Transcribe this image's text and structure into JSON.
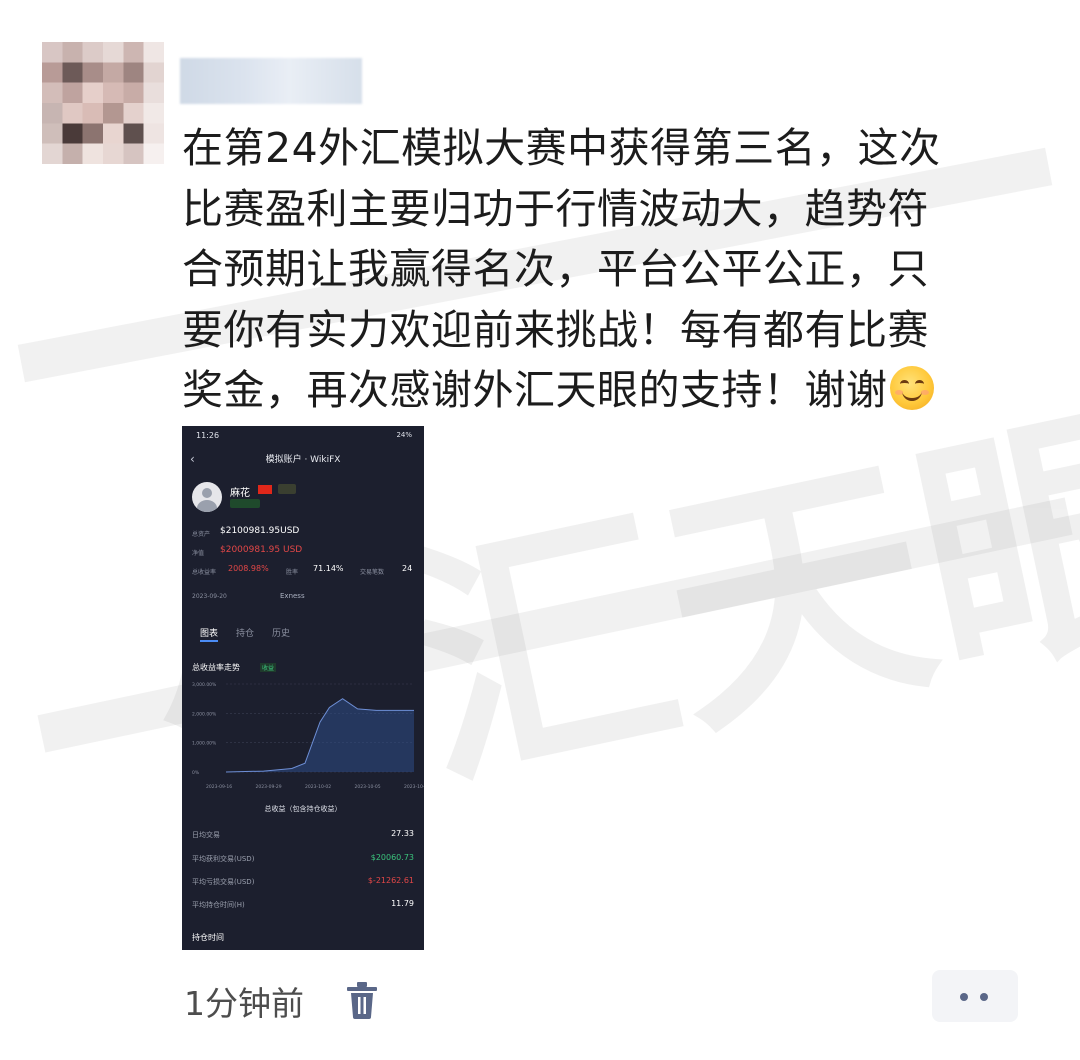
{
  "post": {
    "author_name": "",
    "text_lines": [
      "在第24外汇模拟大赛中获得第三名，这次",
      "比赛盈利主要归功于行情波动大，趋势符",
      "合预期让我赢得名次，平台公平公正，只",
      "要你有实力欢迎前来挑战！每有都有比赛",
      "奖金，再次感谢外汇天眼的支持！谢谢"
    ],
    "emoji": "smiling-face-emoji",
    "time": "1分钟前",
    "delete_icon": "trash-icon",
    "more_icon": "more-dots-icon"
  },
  "watermark": {
    "text": "外汇天眼"
  },
  "screenshot": {
    "status_time": "11:26",
    "status_right": "24%",
    "nav_title": "模拟账户 · WikiFX",
    "user_name": "麻花",
    "total_assets_label": "总资产",
    "total_assets": "$2100981.95USD",
    "net_value_label": "净值",
    "net_value": "$2000981.95 USD",
    "return_label": "总收益率",
    "return_value": "2008.98%",
    "win_rate_label": "胜率",
    "win_rate": "71.14%",
    "trades_label": "交易笔数",
    "trades": "24",
    "start_date": "2023-09-20",
    "broker": "Exness",
    "tabs": [
      "图表",
      "持仓",
      "历史"
    ],
    "chart_title": "总收益率走势",
    "chart_tag": "收益",
    "chart_footer": "总收益（包含持仓收益）",
    "stats": [
      {
        "label": "日均交易",
        "value": "27.33",
        "color": "#ffffff"
      },
      {
        "label": "平均获利交易(USD)",
        "value": "$20060.73",
        "color": "#3bc47c"
      },
      {
        "label": "平均亏损交易(USD)",
        "value": "$-21262.61",
        "color": "#e24747"
      },
      {
        "label": "平均持仓时间(H)",
        "value": "11.79",
        "color": "#ffffff"
      }
    ],
    "section_title": "持仓时间"
  },
  "chart_data": {
    "type": "area",
    "title": "总收益率走势",
    "xlabel": "",
    "ylabel": "",
    "x": [
      "2023-09-16",
      "2023-09-29",
      "2023-10-02",
      "2023-10-05",
      "2023-10-08"
    ],
    "y_ticks": [
      "3,000.00%",
      "2,000.00%",
      "1,000.00%",
      "0%"
    ],
    "ylim": [
      0,
      3000
    ],
    "series": [
      {
        "values_x": [
          0,
          0.2,
          0.35,
          0.42,
          0.5,
          0.55,
          0.62,
          0.7,
          0.8,
          1.0
        ],
        "values": [
          0,
          30,
          120,
          300,
          1700,
          2200,
          2500,
          2150,
          2100,
          2100
        ]
      }
    ],
    "grid": true
  }
}
